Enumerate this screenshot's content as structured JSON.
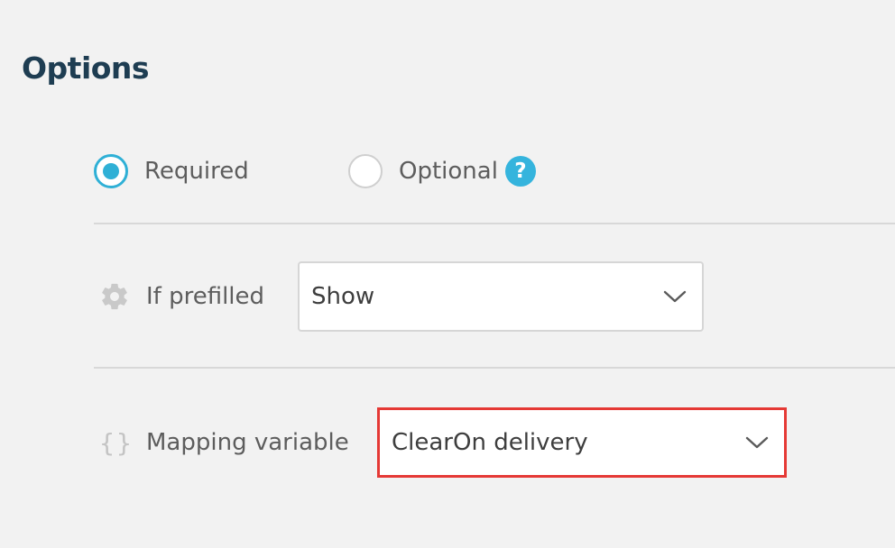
{
  "section": {
    "title": "Options"
  },
  "requirement": {
    "required_label": "Required",
    "optional_label": "Optional",
    "selected": "Required",
    "help_glyph": "?"
  },
  "prefilled": {
    "label": "If prefilled",
    "value": "Show",
    "icon": "gear-icon"
  },
  "mapping": {
    "label": "Mapping variable",
    "value": "ClearOn delivery",
    "icon": "braces-icon",
    "braces_glyph": "{}",
    "highlight_color": "#e53935"
  },
  "colors": {
    "accent": "#2fb0d6",
    "title": "#1e3d52",
    "background": "#f2f2f2"
  }
}
